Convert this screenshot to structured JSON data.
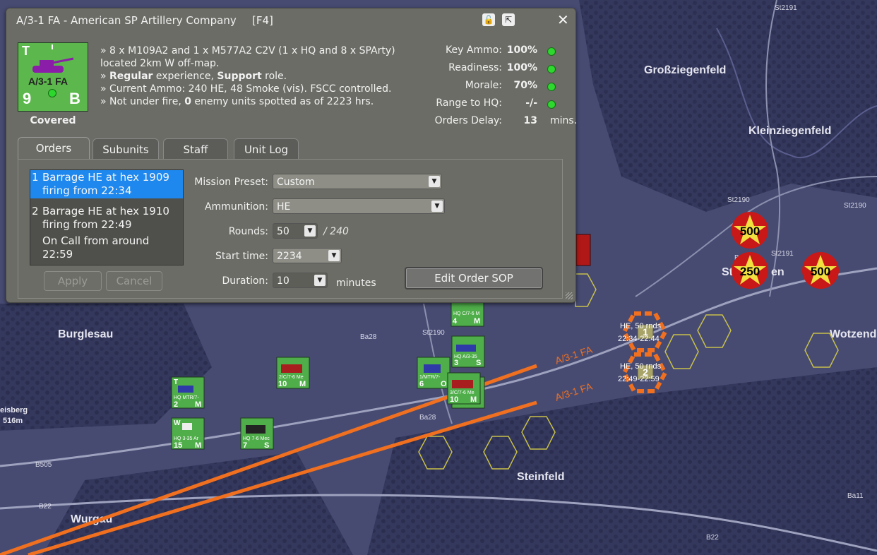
{
  "dialog": {
    "title": "A/3-1 FA - American SP Artillery Company",
    "hotkey": "[F4]",
    "unlock_icon": "padlock-icon",
    "expand_icon": "expand-icon",
    "close_icon": "close-icon",
    "close_glyph": "✕",
    "portrait": {
      "type_letter": "T",
      "unit_label": "A/3-1 FA",
      "strength": "9",
      "grade": "B",
      "vehicle_icon": "sp-artillery-icon"
    },
    "status": "Covered",
    "description": {
      "line1": "» 8 x M109A2 and 1 x M577A2 C2V (1 x HQ and 8 x SPArty) located 2km W off-map.",
      "line2_pre": "» ",
      "line2_b1": "Regular",
      "line2_mid": " experience, ",
      "line2_b2": "Support",
      "line2_post": " role.",
      "line3": "» Current Ammo: 240 HE, 48 Smoke (vis). FSCC controlled.",
      "line4_pre": "» Not under fire, ",
      "line4_b": "0",
      "line4_post": " enemy units spotted as of 2223 hrs."
    },
    "stats": [
      {
        "label": "Key Ammo:",
        "value": "100%",
        "indicator": "green"
      },
      {
        "label": "Readiness:",
        "value": "100%",
        "indicator": "green"
      },
      {
        "label": "Morale:",
        "value": "70%",
        "indicator": "green"
      },
      {
        "label": "Range to HQ:",
        "value": "-/-",
        "indicator": "green"
      }
    ],
    "orders_delay": {
      "label": "Orders Delay:",
      "value": "13",
      "unit": "mins."
    },
    "tabs": [
      "Orders",
      "Subunits",
      "Staff",
      "Unit Log"
    ],
    "active_tab": "Orders",
    "orders": [
      {
        "num": "1",
        "line1": "Barrage HE at hex 1909",
        "line2": "firing from 22:34",
        "selected": true
      },
      {
        "num": "2",
        "line1": "Barrage HE at hex 1910",
        "line2": "firing from 22:49",
        "selected": false
      },
      {
        "num": "",
        "line1": "On Call  from around 22:59",
        "line2": "",
        "selected": false
      }
    ],
    "apply_label": "Apply",
    "cancel_label": "Cancel",
    "form": {
      "mission_preset_label": "Mission Preset:",
      "mission_preset_value": "Custom",
      "ammunition_label": "Ammunition:",
      "ammunition_value": "HE",
      "rounds_label": "Rounds:",
      "rounds_value": "50",
      "rounds_max": "/ 240",
      "start_time_label": "Start time:",
      "start_time_value": "2234",
      "duration_label": "Duration:",
      "duration_value": "10",
      "duration_unit": "minutes"
    },
    "edit_sop_label": "Edit Order SOP"
  },
  "map": {
    "place_names": {
      "grossziegenfeld": "Großziegenfeld",
      "kleinziegenfeld": "Kleinziegenfeld",
      "burglesau": "Burglesau",
      "steinfeld": "Steinfeld",
      "wotzendo": "Wotzendo",
      "wurgau": "Wurgau",
      "st_partial": "St",
      "en_partial": "en",
      "eisberg": "eisberg",
      "eisberg_elev": "516m"
    },
    "roads": [
      "St2191",
      "St2190",
      "St2190",
      "Ba26",
      "St2191",
      "Ba28",
      "St2190",
      "Ba28",
      "B505",
      "B22",
      "B22",
      "Ba11"
    ],
    "fire_missions": [
      {
        "text": "HE, 50 rnds",
        "time": "22:34-22:44",
        "marker": "1"
      },
      {
        "text": "HE, 50 rnds",
        "time": "22:49-22:59",
        "marker": "2"
      }
    ],
    "fire_line_label": "A/3-1 FA",
    "enemy_strikes": [
      "500",
      "250",
      "500"
    ],
    "units": [
      {
        "label": "HQ C/7-6 M",
        "strength": "4",
        "grade": "M"
      },
      {
        "label": "HQ A/3-35",
        "strength": "3",
        "grade": "S"
      },
      {
        "label": "2/C/7-6 Me",
        "strength": "10",
        "grade": "M"
      },
      {
        "label": "1/MTR/7-",
        "strength": "6",
        "grade": "O"
      },
      {
        "label": "3/C/7-6 Me",
        "strength": "10",
        "grade": "M"
      },
      {
        "label": "HQ MTR/7-",
        "strength": "2",
        "grade": "M"
      },
      {
        "label": "HQ 3-35 Ar",
        "strength": "15",
        "grade": "M"
      },
      {
        "label": "HQ 7-6 Mec",
        "strength": "7",
        "grade": "S"
      }
    ],
    "colors": {
      "map_bg": "#3f4268",
      "fire_line": "#f07020",
      "friendly_counter": "#4fae4a",
      "strike_red": "#c81818",
      "strike_yellow": "#f2e040"
    }
  }
}
